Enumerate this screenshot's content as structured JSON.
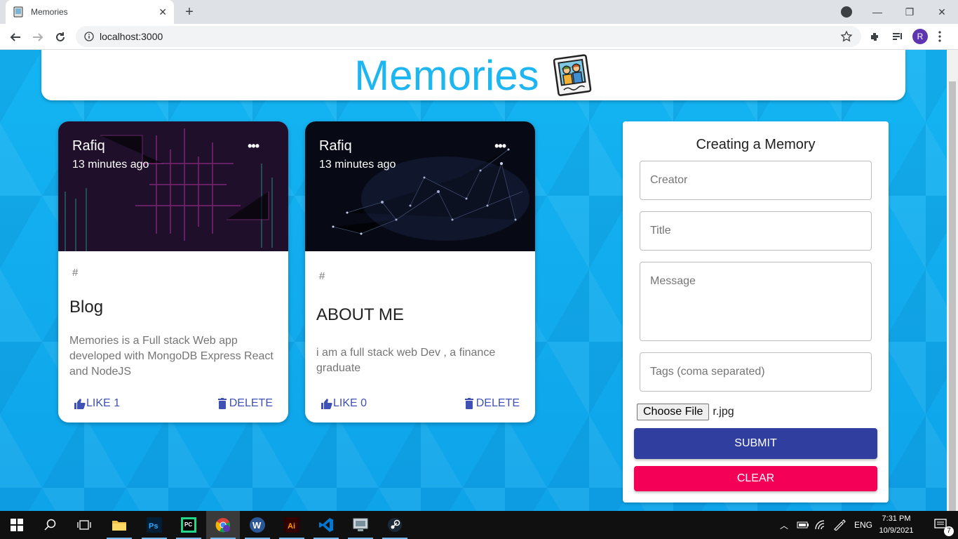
{
  "browser": {
    "tab_title": "Memories",
    "url": "localhost:3000",
    "profile_initial": "R"
  },
  "app": {
    "heading": "Memories"
  },
  "posts": [
    {
      "author": "Rafiq",
      "time": "13 minutes ago",
      "tags": "#",
      "title": "Blog",
      "message": "Memories is a Full stack Web app developed with MongoDB Express React and NodeJS",
      "like_label": "LIKE 1",
      "delete_label": "DELETE"
    },
    {
      "author": "Rafiq",
      "time": "13 minutes ago",
      "tags": "#",
      "title": "ABOUT ME",
      "message": "i am a full stack web Dev , a finance graduate",
      "like_label": "LIKE 0",
      "delete_label": "DELETE"
    }
  ],
  "form": {
    "title": "Creating a Memory",
    "creator_placeholder": "Creator",
    "title_placeholder": "Title",
    "message_placeholder": "Message",
    "tags_placeholder": "Tags (coma separated)",
    "file_button": "Choose File",
    "file_name": "r.jpg",
    "submit_label": "SUBMIT",
    "clear_label": "CLEAR"
  },
  "taskbar": {
    "language": "ENG",
    "time": "7:31 PM",
    "date": "10/9/2021",
    "notification_count": "7"
  },
  "colors": {
    "accent_heading": "#1eb6f0",
    "primary": "#303f9f",
    "secondary": "#f50057",
    "background": "#0ea4ea"
  }
}
